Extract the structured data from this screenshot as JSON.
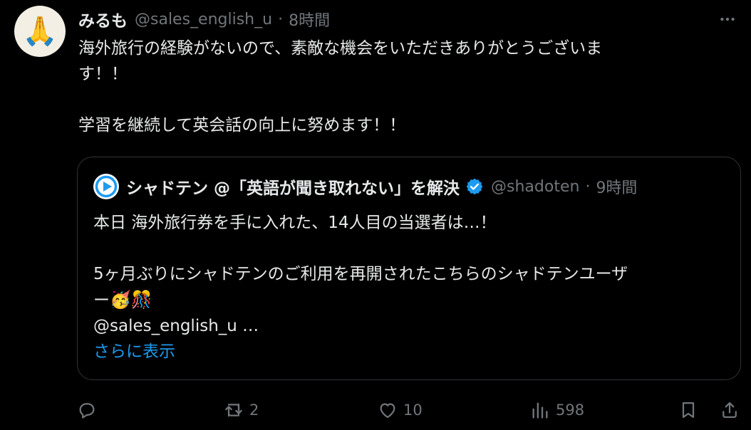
{
  "post": {
    "avatar_emoji": "🙏",
    "display_name": "みるも",
    "handle": "@sales_english_u",
    "separator": "·",
    "time": "8時間",
    "text_lines": [
      "海外旅行の経験がないので、素敵な機会をいただきありがとうございま",
      "す！！",
      "",
      "学習を継続して英会話の向上に努めます！！"
    ]
  },
  "quote": {
    "display_name": "シャドテン @「英語が聞き取れない」を解決",
    "handle": "@shadoten",
    "separator": "·",
    "time": "9時間",
    "lines": [
      "本日 海外旅行券を手に入れた、14人目の当選者は…！",
      "",
      "5ヶ月ぶりにシャドテンのご利用を再開されたこちらのシャドテンユーザ",
      "ー"
    ],
    "emoji_1": "🥳",
    "emoji_2": "🎊",
    "mention_line": "@sales_english_u …",
    "show_more": "さらに表示",
    "brand_color": "#1d9bf0"
  },
  "actions": {
    "reply_count": "",
    "retweet_count": "2",
    "like_count": "10",
    "views_count": "598"
  }
}
